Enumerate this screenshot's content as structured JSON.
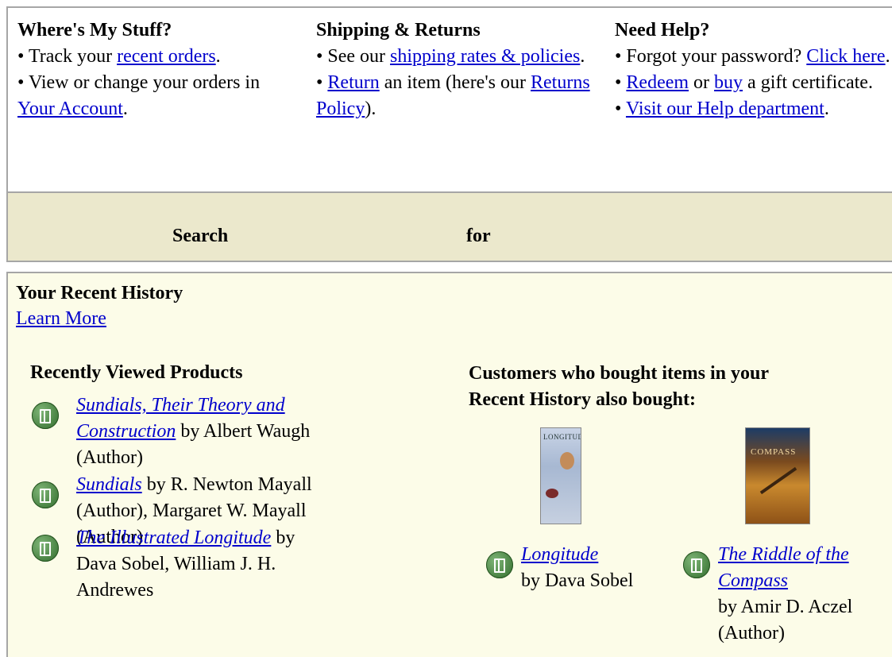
{
  "help": {
    "col1": {
      "title": "Where's My Stuff?",
      "line1_pre": "• Track your ",
      "line1_link": "recent orders",
      "line1_post": ".",
      "line2_pre": "• View or change your orders in ",
      "line2_link": "Your Account",
      "line2_post": "."
    },
    "col2": {
      "title": "Shipping & Returns",
      "line1_pre": "• See our ",
      "line1_link": "shipping rates & policies",
      "line1_post": ".",
      "line2_pre": "• ",
      "line2_link": "Return",
      "line2_mid": " an item (here's our ",
      "line2_link2": "Returns Policy",
      "line2_post": ")."
    },
    "col3": {
      "title": "Need Help?",
      "line1_pre": "• Forgot your password? ",
      "line1_link": "Click here",
      "line1_post": ".",
      "line2_pre": "• ",
      "line2_link": "Redeem",
      "line2_mid": " or ",
      "line2_link2": "buy",
      "line2_post": " a gift certificate.",
      "line3_pre": "• ",
      "line3_link": "Visit our Help department",
      "line3_post": "."
    }
  },
  "search": {
    "label": "Search",
    "for_label": "for"
  },
  "history": {
    "title": "Your Recent History",
    "learn_more": "Learn More",
    "recently_viewed_title": "Recently Viewed Products",
    "recently_viewed": [
      {
        "title": "Sundials, Their Theory and Construction",
        "byline": " by Albert Waugh (Author)"
      },
      {
        "title": "Sundials",
        "byline": " by R. Newton Mayall (Author), Margaret W. Mayall (Author)"
      },
      {
        "title": "The Illustrated Longitude",
        "byline": " by Dava Sobel, William J. H. Andrewes"
      }
    ],
    "also_bought_title": "Customers who bought items in your Recent History also bought:",
    "also_bought": [
      {
        "title": "Longitude",
        "byline": "by Dava Sobel",
        "cover_text": "LONGITUDE"
      },
      {
        "title": "The Riddle of the Compass",
        "byline": "by Amir D. Aczel (Author)",
        "cover_text": "COMPASS"
      }
    ]
  }
}
